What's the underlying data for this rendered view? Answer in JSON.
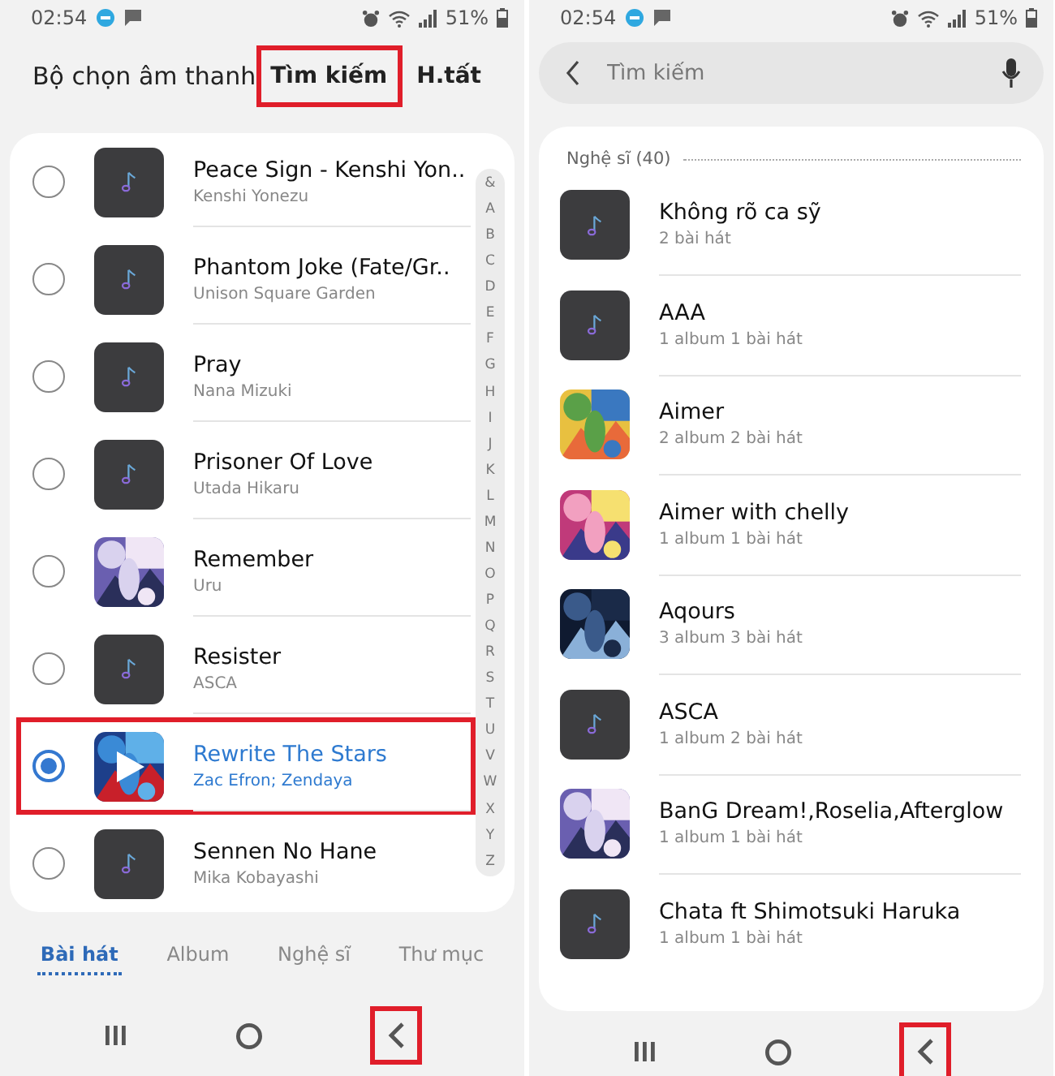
{
  "left": {
    "status_bar": {
      "time": "02:54",
      "battery": "51%"
    },
    "header": {
      "title": "Bộ chọn âm thanh",
      "actions": [
        {
          "label": "Tìm kiếm",
          "highlighted": true
        },
        {
          "label": "H.tất",
          "highlighted": false
        }
      ]
    },
    "songs": [
      {
        "title": "Peace Sign - Kenshi Yon..",
        "artist": "Kenshi Yonezu",
        "kind": "note",
        "selected": false,
        "highlighted": false
      },
      {
        "title": "Phantom Joke (Fate/Gr..",
        "artist": "Unison Square Garden",
        "kind": "note",
        "selected": false,
        "highlighted": false
      },
      {
        "title": "Pray",
        "artist": "Nana Mizuki",
        "kind": "note",
        "selected": false,
        "highlighted": false
      },
      {
        "title": "Prisoner Of Love",
        "artist": "Utada Hikaru",
        "kind": "note",
        "selected": false,
        "highlighted": false
      },
      {
        "title": "Remember",
        "artist": "Uru",
        "kind": "picture",
        "selected": false,
        "highlighted": false
      },
      {
        "title": "Resister",
        "artist": "ASCA",
        "kind": "note",
        "selected": false,
        "highlighted": false
      },
      {
        "title": "Rewrite The Stars",
        "artist": "Zac Efron; Zendaya",
        "kind": "picture",
        "selected": true,
        "highlighted": true
      },
      {
        "title": "Sennen No Hane",
        "artist": "Mika Kobayashi",
        "kind": "note",
        "selected": false,
        "highlighted": false
      }
    ],
    "index": [
      "&",
      "A",
      "B",
      "C",
      "D",
      "E",
      "F",
      "G",
      "H",
      "I",
      "J",
      "K",
      "L",
      "M",
      "N",
      "O",
      "P",
      "Q",
      "R",
      "S",
      "T",
      "U",
      "V",
      "W",
      "X",
      "Y",
      "Z"
    ],
    "tabs": [
      {
        "label": "Bài hát",
        "selected": true
      },
      {
        "label": "Album",
        "selected": false
      },
      {
        "label": "Nghệ sĩ",
        "selected": false
      },
      {
        "label": "Thư mục",
        "selected": false
      }
    ],
    "nav": {
      "back_highlighted": true
    }
  },
  "right": {
    "status_bar": {
      "time": "02:54",
      "battery": "51%"
    },
    "search": {
      "placeholder": "Tìm kiếm"
    },
    "section": {
      "title": "Nghệ sĩ (40)"
    },
    "artists": [
      {
        "name": "Không rõ ca sỹ",
        "detail": "2 bài hát",
        "kind": "note"
      },
      {
        "name": "AAA",
        "detail": "1 album 1 bài hát",
        "kind": "note"
      },
      {
        "name": "Aimer",
        "detail": "2 album 2 bài hát",
        "kind": "picture"
      },
      {
        "name": "Aimer with chelly",
        "detail": "1 album 1 bài hát",
        "kind": "picture"
      },
      {
        "name": "Aqours",
        "detail": "3 album 3 bài hát",
        "kind": "picture"
      },
      {
        "name": "ASCA",
        "detail": "1 album 2 bài hát",
        "kind": "note"
      },
      {
        "name": "BanG Dream!,Roselia,Afterglow",
        "detail": "1 album 1 bài hát",
        "kind": "picture"
      },
      {
        "name": "Chata ft Shimotsuki Haruka",
        "detail": "1 album 1 bài hát",
        "kind": "note"
      }
    ],
    "nav": {
      "back_highlighted": true
    }
  }
}
